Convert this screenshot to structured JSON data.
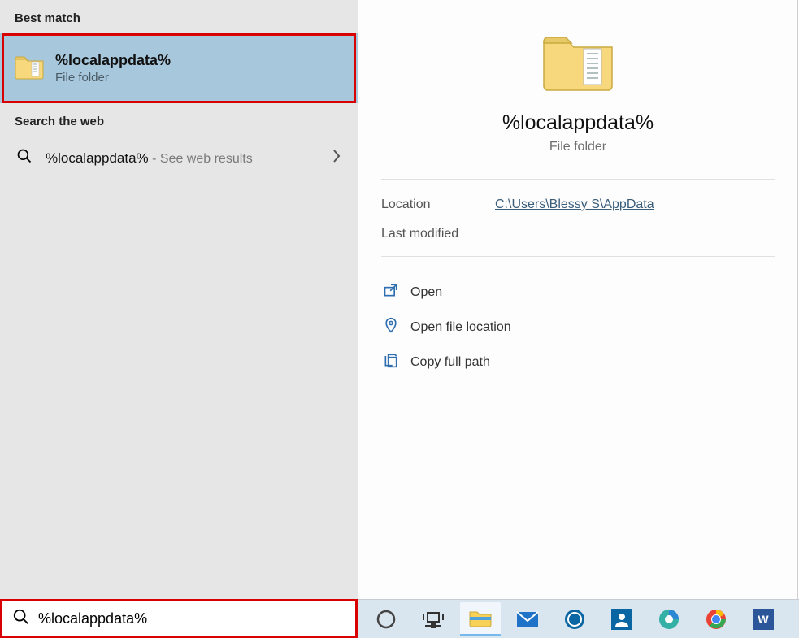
{
  "left": {
    "best_match_header": "Best match",
    "result": {
      "title": "%localappdata%",
      "subtitle": "File folder"
    },
    "web_header": "Search the web",
    "web_row": {
      "query": "%localappdata%",
      "suffix": " - See web results"
    }
  },
  "details": {
    "title": "%localappdata%",
    "subtitle": "File folder",
    "location_label": "Location",
    "location_value": "C:\\Users\\Blessy S\\AppData",
    "modified_label": "Last modified",
    "modified_value": "",
    "actions": {
      "open": "Open",
      "open_location": "Open file location",
      "copy_path": "Copy full path"
    }
  },
  "search": {
    "value": "%localappdata%"
  },
  "taskbar": {
    "items": [
      {
        "name": "cortana-icon"
      },
      {
        "name": "task-view-icon"
      },
      {
        "name": "file-explorer-icon"
      },
      {
        "name": "mail-icon"
      },
      {
        "name": "dell-icon"
      },
      {
        "name": "people-icon"
      },
      {
        "name": "edge-icon"
      },
      {
        "name": "chrome-icon"
      },
      {
        "name": "word-icon"
      }
    ]
  }
}
